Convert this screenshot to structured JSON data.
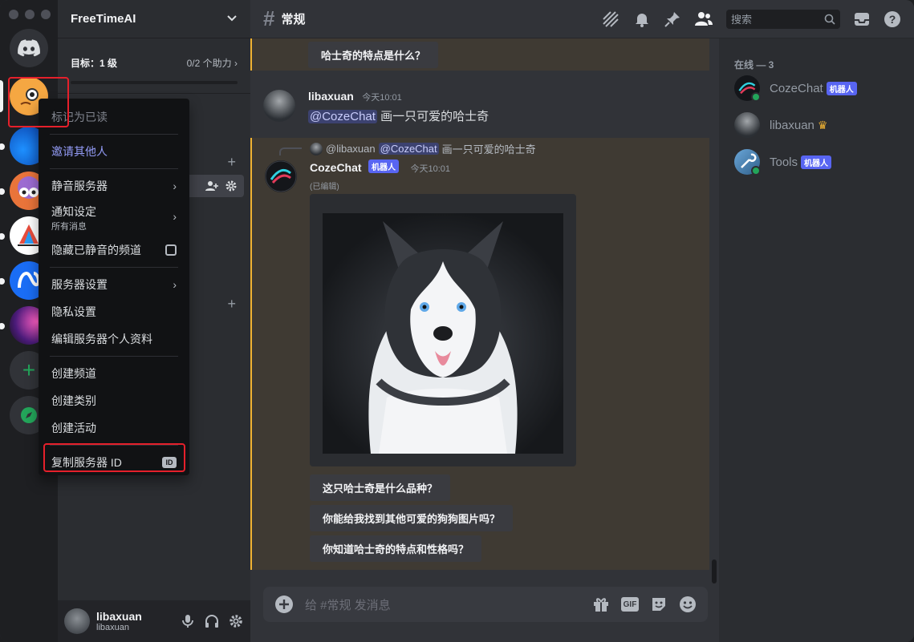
{
  "server": {
    "name": "FreeTimeAI",
    "goal_label": "目标：1 级",
    "goal_progress": "0/2 个助力",
    "goal_fraction": 0
  },
  "context_menu": {
    "mark_read": "标记为已读",
    "invite": "邀请其他人",
    "mute": "静音服务器",
    "notifications": "通知设定",
    "notifications_sub": "所有消息",
    "hide_muted": "隐藏已静音的频道",
    "server_settings": "服务器设置",
    "privacy": "隐私设置",
    "edit_profile": "编辑服务器个人资料",
    "create_channel": "创建频道",
    "create_category": "创建类别",
    "create_event": "创建活动",
    "copy_id": "复制服务器 ID",
    "id_badge": "ID"
  },
  "channel": {
    "name": "常规",
    "search_placeholder": "搜索"
  },
  "messages": {
    "top_chip": "哈士奇的特点是什么？",
    "user_msg": {
      "author": "libaxuan",
      "time": "今天10:01",
      "mention": "@CozeChat",
      "text": "画一只可爱的哈士奇"
    },
    "bot_msg": {
      "reply_author": "@libaxuan",
      "reply_mention": "@CozeChat",
      "reply_text": "画一只可爱的哈士奇",
      "author": "CozeChat",
      "badge": "机器人",
      "time": "今天10:01",
      "edited": "(已编辑)",
      "suggestions": [
        "这只哈士奇是什么品种？",
        "你能给我找到其他可爱的狗狗图片吗？",
        "你知道哈士奇的特点和性格吗？"
      ]
    }
  },
  "composer": {
    "placeholder": "给 #常规 发消息",
    "gif_label": "GIF"
  },
  "members": {
    "category": "在线 — 3",
    "list": [
      {
        "name": "CozeChat",
        "badge": "机器人"
      },
      {
        "name": "libaxuan",
        "crown": "♛"
      },
      {
        "name": "Tools",
        "badge": "机器人"
      }
    ]
  },
  "user_panel": {
    "name": "libaxuan",
    "username": "libaxuan"
  }
}
